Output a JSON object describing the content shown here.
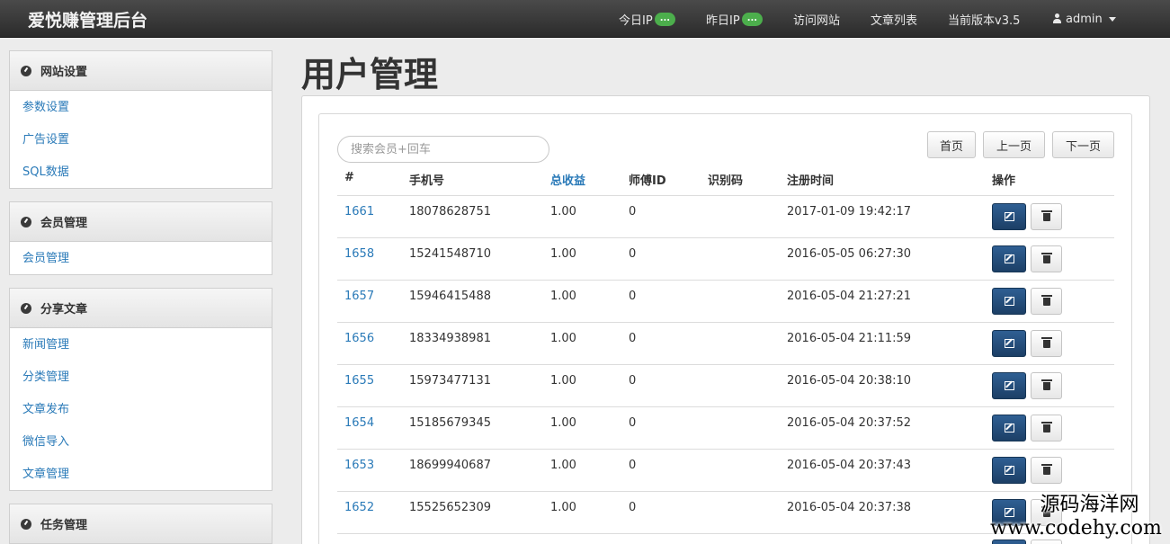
{
  "app": {
    "title": "爱悦赚管理后台"
  },
  "nav": {
    "today_ip_label": "今日IP",
    "today_ip_badge": "...",
    "yesterday_ip_label": "昨日IP",
    "yesterday_ip_badge": "...",
    "visit_site": "访问网站",
    "article_list": "文章列表",
    "version": "当前版本v3.5",
    "user": "admin",
    "badge_color": "#4cae4c"
  },
  "sidebar": {
    "site_settings": {
      "title": "网站设置",
      "items": [
        "参数设置",
        "广告设置",
        "SQL数据"
      ]
    },
    "members": {
      "title": "会员管理",
      "items": [
        "会员管理"
      ]
    },
    "articles": {
      "title": "分享文章",
      "items": [
        "新闻管理",
        "分类管理",
        "文章发布",
        "微信导入",
        "文章管理"
      ]
    },
    "tasks": {
      "title": "任务管理"
    }
  },
  "main": {
    "page_title": "用户管理",
    "search_placeholder": "搜索会员+回车",
    "pager": {
      "first": "首页",
      "prev": "上一页",
      "next": "下一页"
    },
    "columns": {
      "id": "#",
      "phone": "手机号",
      "earnings": "总收益",
      "master_id": "师傅ID",
      "code": "识别码",
      "registered": "注册时间",
      "actions": "操作"
    },
    "rows": [
      {
        "id": "1661",
        "phone": "18078628751",
        "earnings": "1.00",
        "master_id": "0",
        "code": "",
        "registered": "2017-01-09 19:42:17"
      },
      {
        "id": "1658",
        "phone": "15241548710",
        "earnings": "1.00",
        "master_id": "0",
        "code": "",
        "registered": "2016-05-05 06:27:30"
      },
      {
        "id": "1657",
        "phone": "15946415488",
        "earnings": "1.00",
        "master_id": "0",
        "code": "",
        "registered": "2016-05-04 21:27:21"
      },
      {
        "id": "1656",
        "phone": "18334938981",
        "earnings": "1.00",
        "master_id": "0",
        "code": "",
        "registered": "2016-05-04 21:11:59"
      },
      {
        "id": "1655",
        "phone": "15973477131",
        "earnings": "1.00",
        "master_id": "0",
        "code": "",
        "registered": "2016-05-04 20:38:10"
      },
      {
        "id": "1654",
        "phone": "15185679345",
        "earnings": "1.00",
        "master_id": "0",
        "code": "",
        "registered": "2016-05-04 20:37:52"
      },
      {
        "id": "1653",
        "phone": "18699940687",
        "earnings": "1.00",
        "master_id": "0",
        "code": "",
        "registered": "2016-05-04 20:37:43"
      },
      {
        "id": "1652",
        "phone": "15525652309",
        "earnings": "1.00",
        "master_id": "0",
        "code": "",
        "registered": "2016-05-04 20:37:38"
      }
    ],
    "link_color": "#2a7ab8",
    "edit_button_color": "#1c3f66"
  },
  "watermark": {
    "line1": "源码海洋网",
    "line2": "www.codehy.com"
  }
}
